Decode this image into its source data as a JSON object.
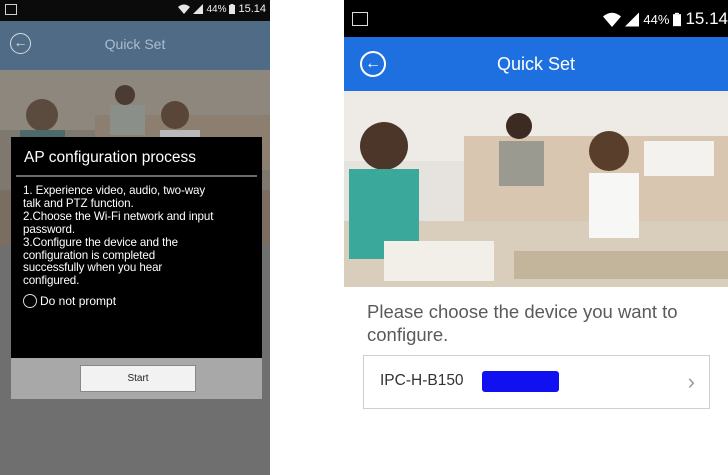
{
  "left": {
    "status_bar": {
      "battery_percent": "44%",
      "time": "15.14"
    },
    "app_bar": {
      "title": "Quick Set"
    },
    "dialog": {
      "title": "AP configuration process",
      "lines": [
        "1. Experience video, audio, two-way",
        "talk and PTZ function.",
        "2.Choose the Wi-Fi network and input",
        "password.",
        "3.Configure the device and the",
        "configuration is completed",
        "successfully when you hear",
        "configured."
      ],
      "checkbox_label": "Do not prompt",
      "button_label": "Start"
    }
  },
  "right": {
    "status_bar": {
      "battery_percent": "44%",
      "time": "15.14"
    },
    "app_bar": {
      "title": "Quick Set"
    },
    "prompt": "Please choose the device you want to configure.",
    "device": {
      "name": "IPC-H-B150"
    }
  },
  "icons": [
    "gallery-icon",
    "wifi-icon",
    "signal-icon",
    "battery-icon",
    "back-arrow-icon",
    "chevron-right-icon"
  ]
}
